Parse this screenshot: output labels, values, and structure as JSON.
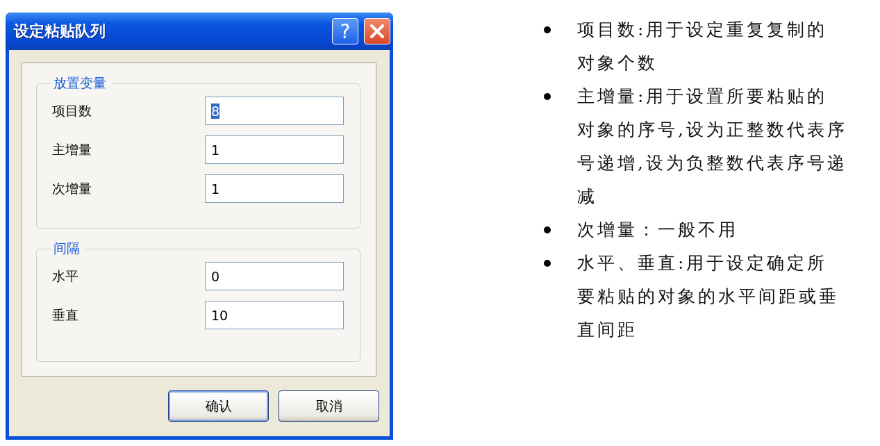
{
  "dialog": {
    "title": "设定粘贴队列",
    "help_button": "?",
    "groups": [
      {
        "title": "放置变量",
        "fields": [
          {
            "label": "项目数",
            "value": "8",
            "text_selected": true
          },
          {
            "label": "主增量",
            "value": "1",
            "text_selected": false
          },
          {
            "label": "次增量",
            "value": "1",
            "text_selected": false
          }
        ]
      },
      {
        "title": "间隔",
        "fields": [
          {
            "label": "水平",
            "value": "0",
            "text_selected": false
          },
          {
            "label": "垂直",
            "value": "10",
            "text_selected": false
          }
        ]
      }
    ],
    "buttons": [
      {
        "label": "确认",
        "default": true
      },
      {
        "label": "取消",
        "default": false
      }
    ]
  },
  "notes": [
    "项目数:用于设定重复复制的对象个数",
    "主增量:用于设置所要粘贴的对象的序号,设为正整数代表序号递增,设为负整数代表序号递减",
    "次增量：一般不用",
    "水平、垂直:用于设定确定所要粘贴的对象的水平间距或垂直间距"
  ]
}
